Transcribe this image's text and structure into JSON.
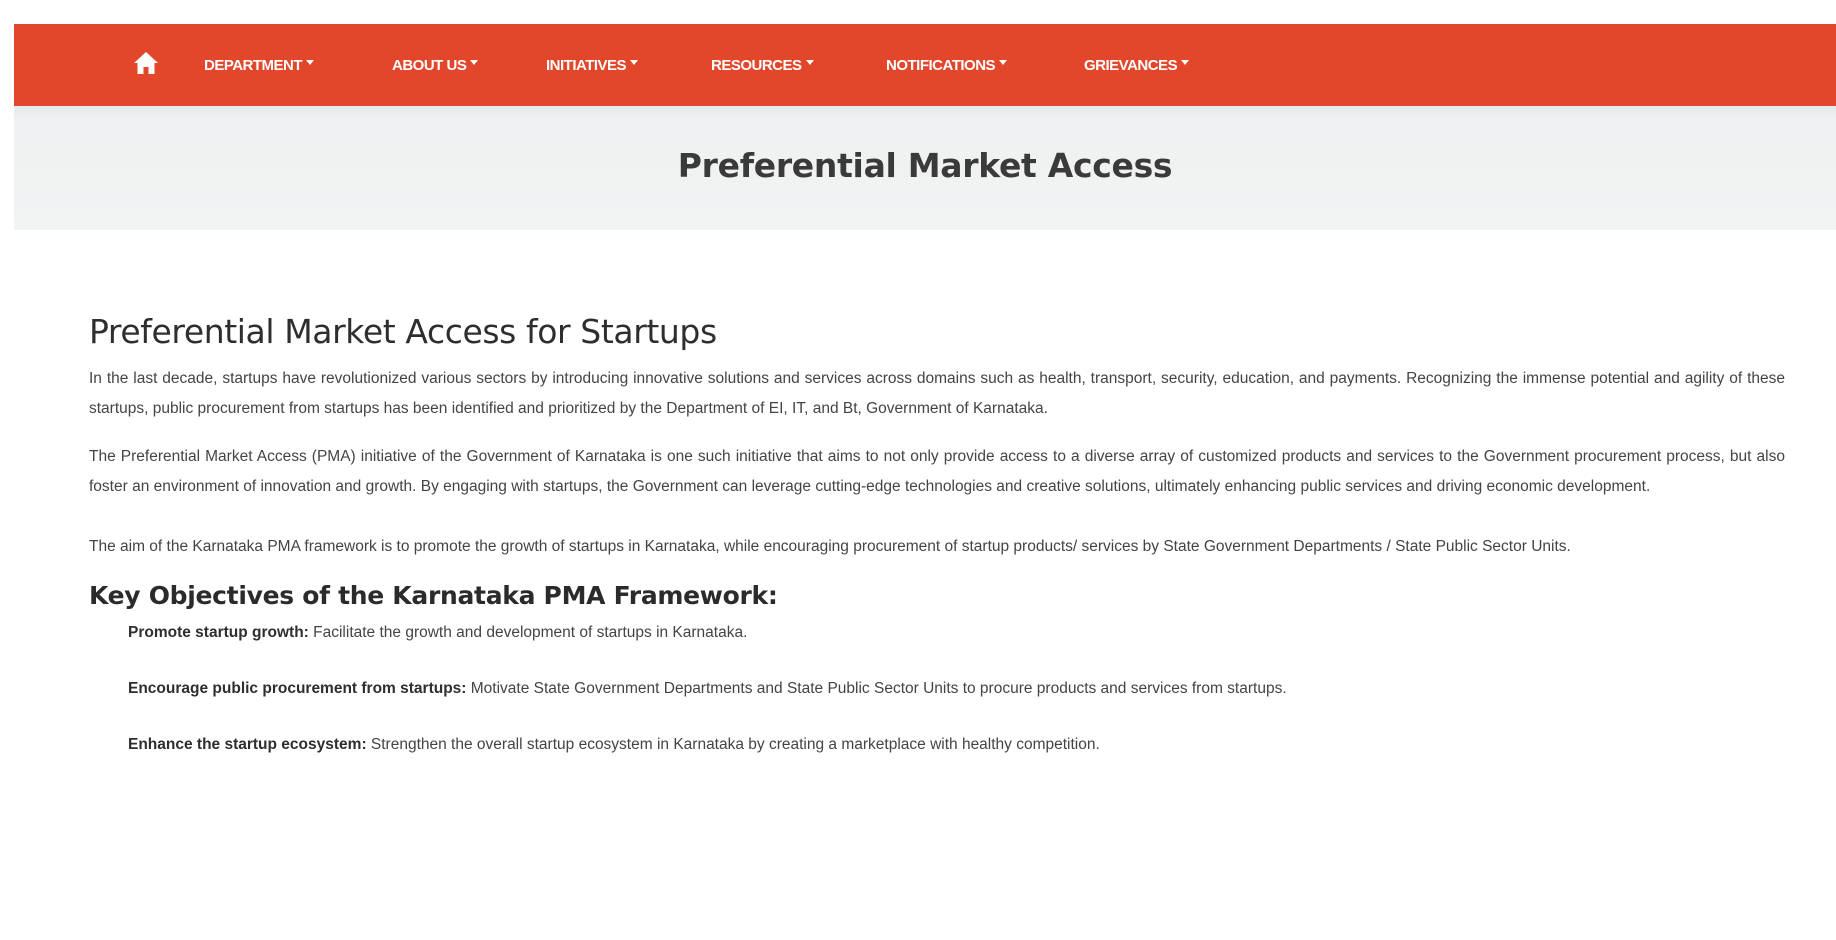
{
  "navbar": {
    "home_icon": "home-icon",
    "items": [
      {
        "label": "DEPARTMENT"
      },
      {
        "label": "ABOUT US"
      },
      {
        "label": "INITIATIVES"
      },
      {
        "label": "RESOURCES"
      },
      {
        "label": "NOTIFICATIONS"
      },
      {
        "label": "GRIEVANCES"
      }
    ],
    "color": "#e2472b"
  },
  "title_band": {
    "title": "Preferential Market Access"
  },
  "content": {
    "heading": "Preferential Market Access for Startups",
    "paragraphs": [
      "In the last decade, startups have revolutionized various sectors by introducing innovative solutions and services across domains such as health, transport, security, education, and payments. Recognizing the immense potential and agility of these startups, public procurement from startups has been identified and prioritized by the Department of EI, IT, and Bt, Government of Karnataka.",
      "The Preferential Market Access (PMA) initiative of the Government of Karnataka is one such initiative that aims to not only provide access to a diverse array of customized products and services to the Government procurement process, but also foster an environment of innovation and growth. By engaging with startups, the Government can leverage cutting-edge technologies and creative solutions, ultimately enhancing public services and driving economic development.",
      "The aim of the Karnataka PMA framework is to promote the growth of startups in Karnataka, while encouraging procurement of startup products/ services by State Government Departments / State Public Sector Units."
    ],
    "objectives_heading": "Key Objectives of the Karnataka PMA Framework:",
    "objectives": [
      {
        "title": "Promote startup growth:",
        "text": " Facilitate the growth and development of startups in Karnataka."
      },
      {
        "title": "Encourage public procurement from startups:",
        "text": " Motivate State Government Departments and State Public Sector Units to procure products and services from startups."
      },
      {
        "title": "Enhance the startup ecosystem:",
        "text": " Strengthen the overall startup ecosystem in Karnataka by creating a marketplace with healthy competition."
      }
    ]
  }
}
